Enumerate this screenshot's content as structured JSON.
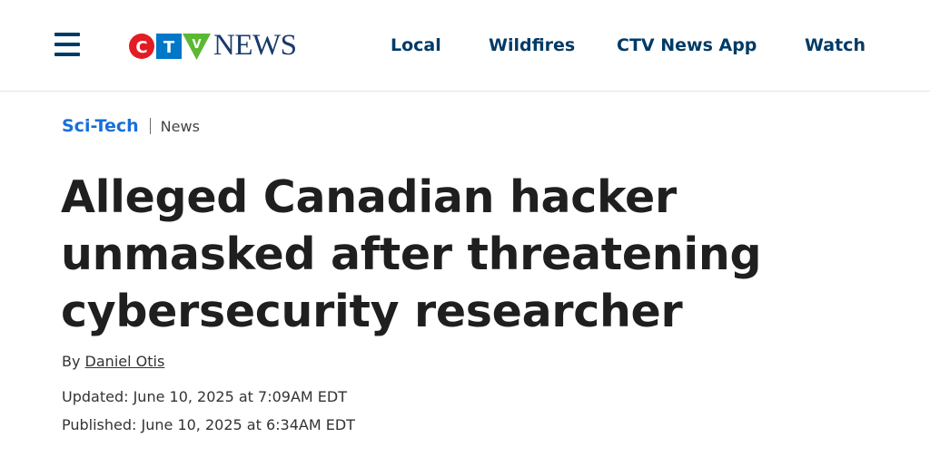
{
  "header": {
    "logo": {
      "ctv_letters": [
        "C",
        "T",
        "V"
      ],
      "wordmark": "NEWS",
      "colors": {
        "red": "#e31b23",
        "blue": "#0077c8",
        "green": "#5bb832",
        "navy": "#1a3a6b"
      }
    },
    "nav": [
      {
        "label": "Local"
      },
      {
        "label": "Wildfires"
      },
      {
        "label": "CTV News App"
      },
      {
        "label": "Watch"
      }
    ],
    "nav_color": "#003a66",
    "menu_icon": "hamburger-menu-icon"
  },
  "breadcrumb": {
    "section": "Sci-Tech",
    "subsection": "News",
    "section_color": "#1a6fd9"
  },
  "article": {
    "headline_lines": [
      "Alleged Canadian hacker",
      "unmasked after threatening",
      "cybersecurity researcher"
    ],
    "byline_prefix": "By",
    "author": "Daniel Otis",
    "updated": "Updated: June 10, 2025 at 7:09AM EDT",
    "published": "Published: June 10, 2025 at 6:34AM EDT"
  }
}
